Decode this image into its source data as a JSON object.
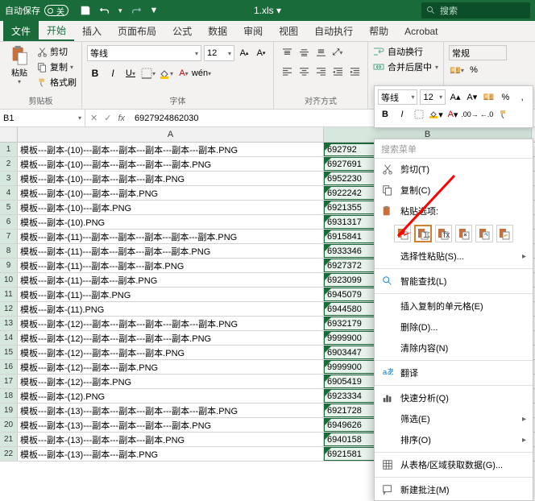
{
  "titlebar": {
    "autosave_label": "自动保存",
    "toggle": "关",
    "filename": "1.xls  ▾",
    "search_placeholder": "搜索"
  },
  "menu": [
    "文件",
    "开始",
    "插入",
    "页面布局",
    "公式",
    "数据",
    "审阅",
    "视图",
    "自动执行",
    "帮助",
    "Acrobat"
  ],
  "ribbon": {
    "clipboard": {
      "paste": "粘贴",
      "cut": "剪切",
      "copy": "复制",
      "format_painter": "格式刷",
      "label": "剪贴板"
    },
    "font": {
      "name": "等线",
      "size": "12",
      "label": "字体",
      "b": "B",
      "i": "I",
      "u": "U",
      "wen": "wén"
    },
    "align": {
      "wrap": "自动换行",
      "merge": "合并后居中",
      "label": "对齐方式"
    },
    "number": {
      "general": "常规",
      "pct": "%"
    }
  },
  "namebox": "B1",
  "fx": "6927924862030",
  "cols": [
    "A",
    "B"
  ],
  "rows": [
    {
      "n": 1,
      "a": "模板---副本-(10)---副本---副本---副本---副本---副本.PNG",
      "b": "692792"
    },
    {
      "n": 2,
      "a": "模板---副本-(10)---副本---副本---副本---副本.PNG",
      "b": "6927691"
    },
    {
      "n": 3,
      "a": "模板---副本-(10)---副本---副本---副本.PNG",
      "b": "6952230"
    },
    {
      "n": 4,
      "a": "模板---副本-(10)---副本---副本.PNG",
      "b": "6922242"
    },
    {
      "n": 5,
      "a": "模板---副本-(10)---副本.PNG",
      "b": "6921355"
    },
    {
      "n": 6,
      "a": "模板---副本-(10).PNG",
      "b": "6931317"
    },
    {
      "n": 7,
      "a": "模板---副本-(11)---副本---副本---副本---副本---副本.PNG",
      "b": "6915841"
    },
    {
      "n": 8,
      "a": "模板---副本-(11)---副本---副本---副本---副本.PNG",
      "b": "6933346"
    },
    {
      "n": 9,
      "a": "模板---副本-(11)---副本---副本---副本.PNG",
      "b": "6927372"
    },
    {
      "n": 10,
      "a": "模板---副本-(11)---副本---副本.PNG",
      "b": "6923099"
    },
    {
      "n": 11,
      "a": "模板---副本-(11)---副本.PNG",
      "b": "6945079"
    },
    {
      "n": 12,
      "a": "模板---副本-(11).PNG",
      "b": "6944580"
    },
    {
      "n": 13,
      "a": "模板---副本-(12)---副本---副本---副本---副本---副本.PNG",
      "b": "6932179"
    },
    {
      "n": 14,
      "a": "模板---副本-(12)---副本---副本---副本---副本.PNG",
      "b": "9999900"
    },
    {
      "n": 15,
      "a": "模板---副本-(12)---副本---副本---副本.PNG",
      "b": "6903447"
    },
    {
      "n": 16,
      "a": "模板---副本-(12)---副本---副本.PNG",
      "b": "9999900"
    },
    {
      "n": 17,
      "a": "模板---副本-(12)---副本.PNG",
      "b": "6905419"
    },
    {
      "n": 18,
      "a": "模板---副本-(12).PNG",
      "b": "6923334"
    },
    {
      "n": 19,
      "a": "模板---副本-(13)---副本---副本---副本---副本---副本.PNG",
      "b": "6921728"
    },
    {
      "n": 20,
      "a": "模板---副本-(13)---副本---副本---副本---副本.PNG",
      "b": "6949626"
    },
    {
      "n": 21,
      "a": "模板---副本-(13)---副本---副本---副本.PNG",
      "b": "6940158"
    },
    {
      "n": 22,
      "a": "模板---副本-(13)---副本---副本.PNG",
      "b": "6921581"
    }
  ],
  "float": {
    "font": "等线",
    "size": "12"
  },
  "context": {
    "search": "搜索菜单",
    "cut": "剪切(T)",
    "copy": "复制(C)",
    "paste_opts": "粘贴选项:",
    "paste_special": "选择性粘贴(S)...",
    "smart_lookup": "智能查找(L)",
    "insert_copied": "插入复制的单元格(E)",
    "delete": "删除(D)...",
    "clear": "清除内容(N)",
    "translate": "翻译",
    "quick_analysis": "快速分析(Q)",
    "filter": "筛选(E)",
    "sort": "排序(O)",
    "from_table": "从表格/区域获取数据(G)...",
    "new_note": "新建批注(M)"
  }
}
